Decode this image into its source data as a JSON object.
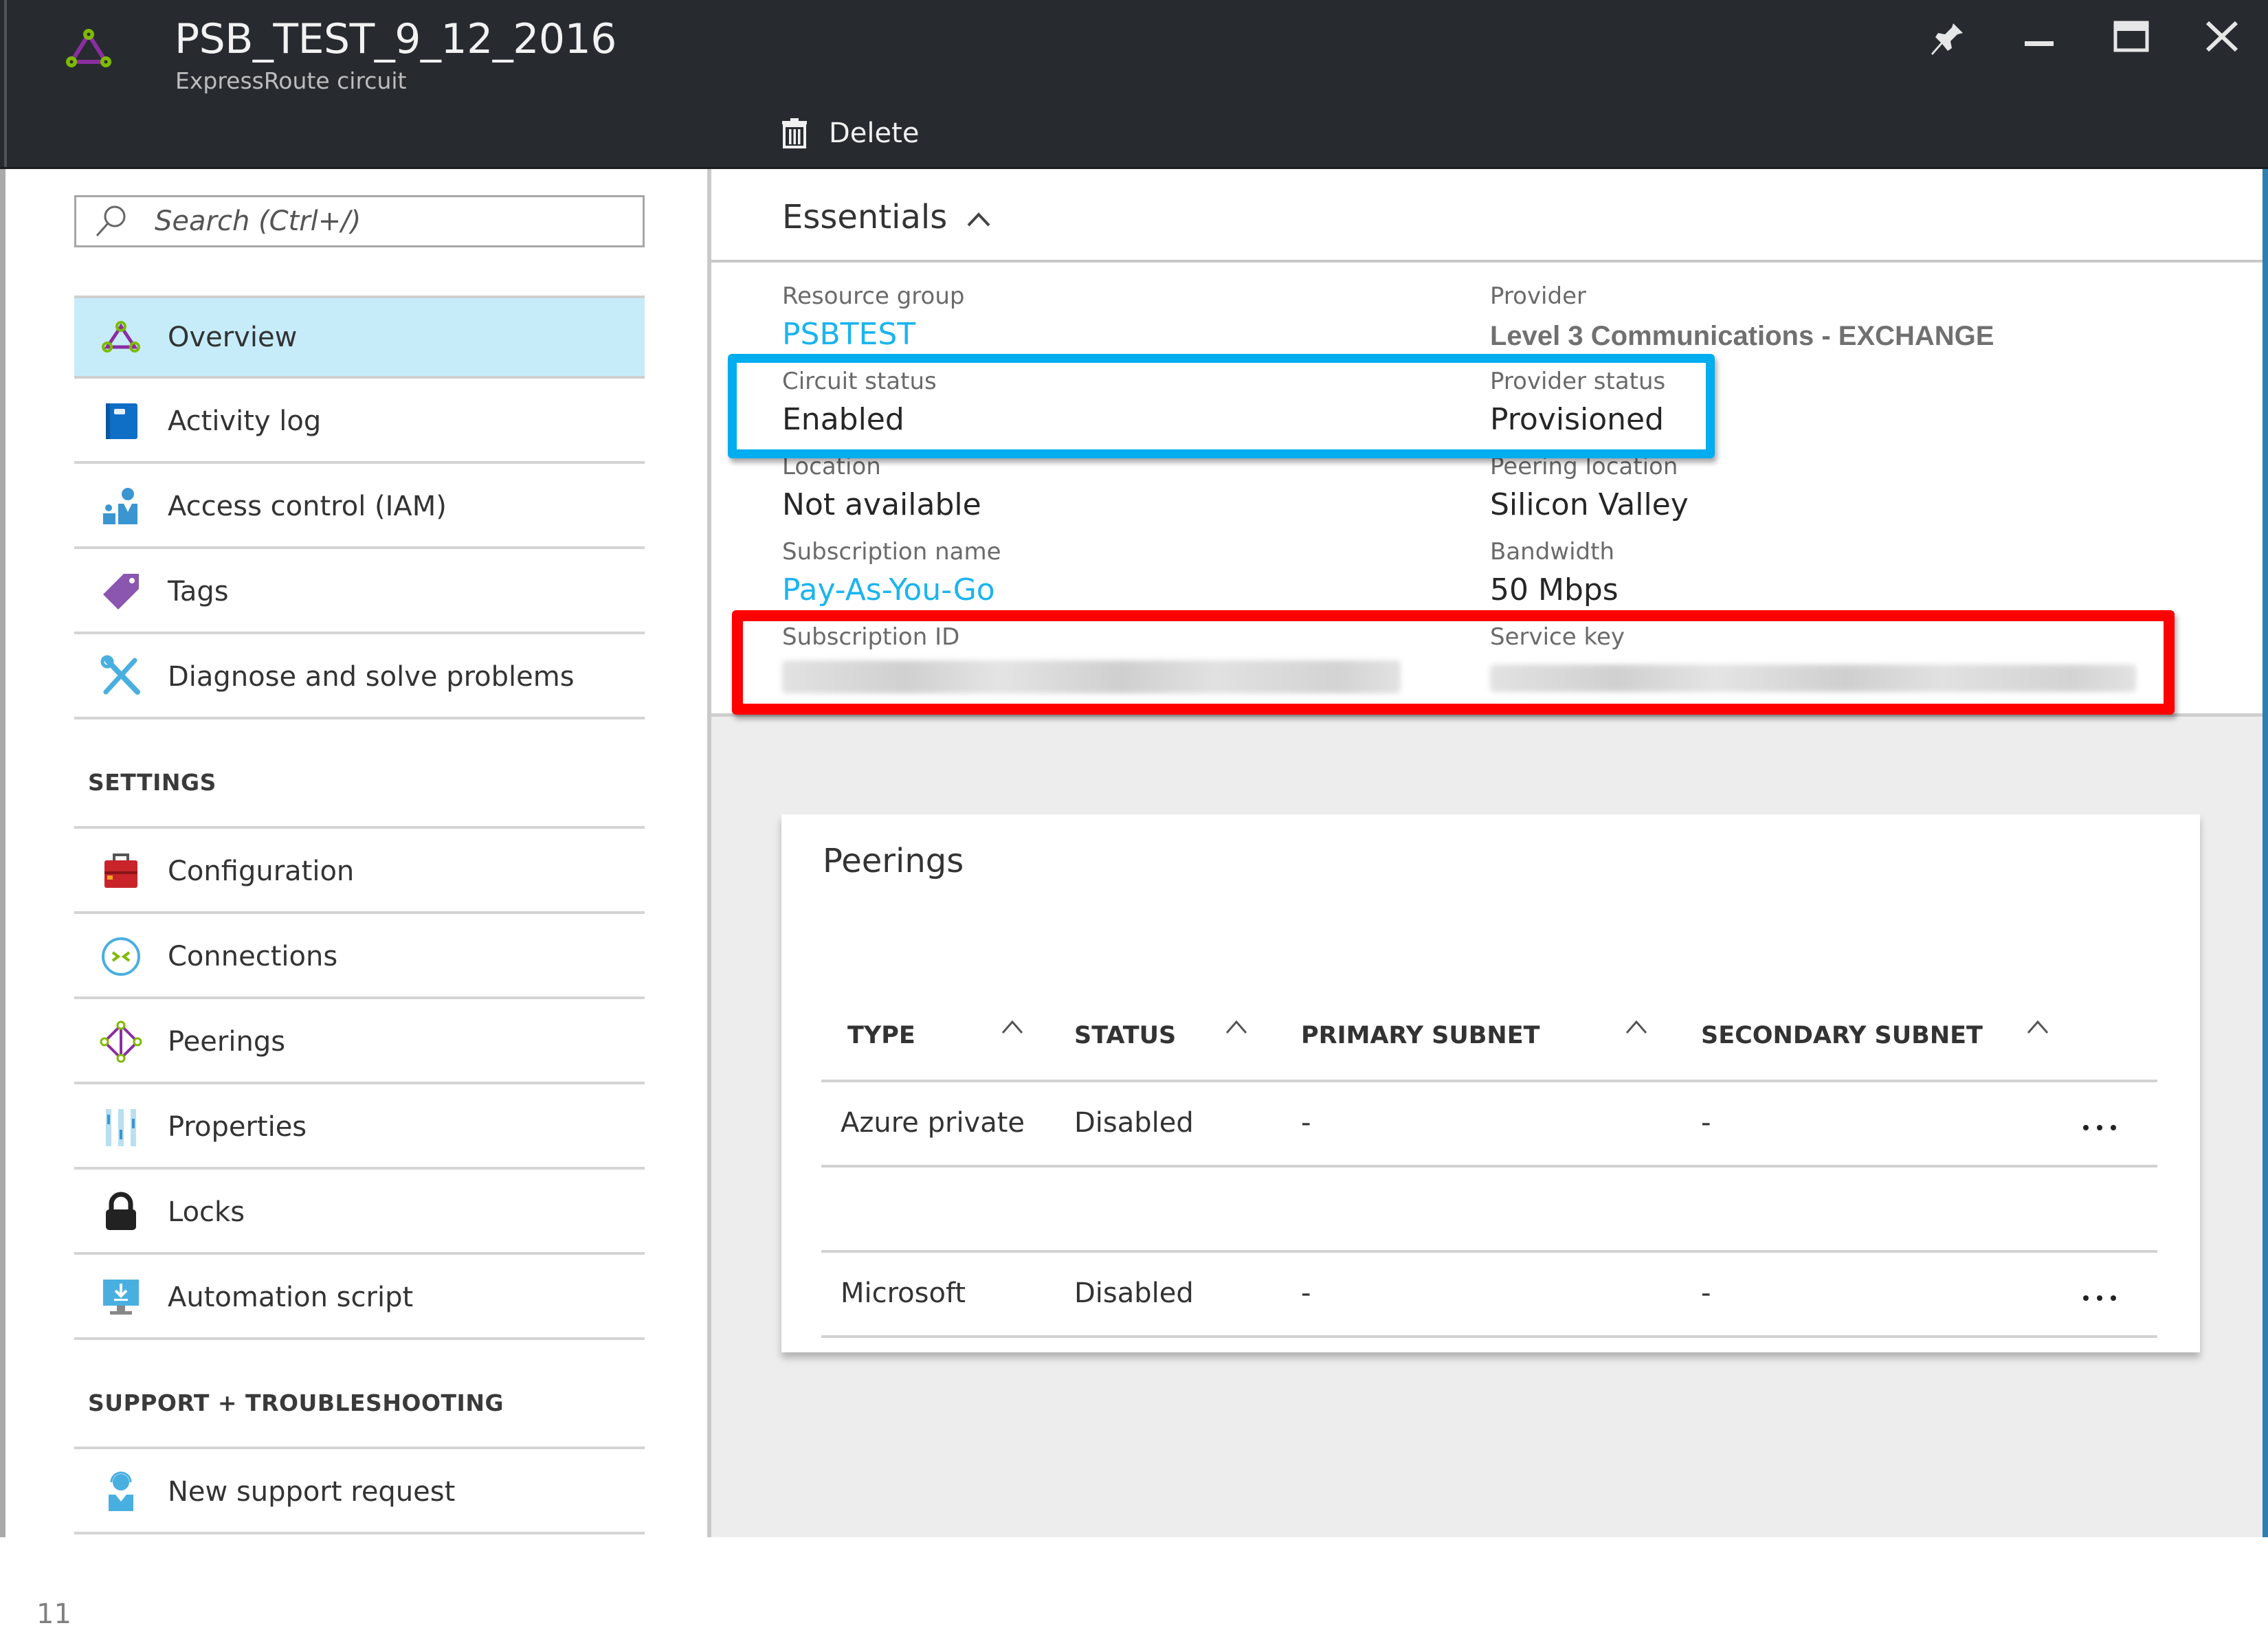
{
  "header": {
    "title": "PSB_TEST_9_12_2016",
    "subtitle": "ExpressRoute circuit",
    "resource_icon": "expressroute-circuit-icon",
    "window_controls": [
      "pin-icon",
      "minimize-icon",
      "maximize-icon",
      "close-icon"
    ],
    "delete_label": "Delete"
  },
  "sidebar": {
    "search_placeholder": "Search (Ctrl+/)",
    "items": [
      {
        "label": "Overview",
        "icon": "expressroute-icon",
        "active": true
      },
      {
        "label": "Activity log",
        "icon": "activity-log-icon"
      },
      {
        "label": "Access control (IAM)",
        "icon": "iam-icon"
      },
      {
        "label": "Tags",
        "icon": "tag-icon"
      },
      {
        "label": "Diagnose and solve problems",
        "icon": "wrench-icon"
      }
    ],
    "settings_label": "SETTINGS",
    "settings_items": [
      {
        "label": "Configuration",
        "icon": "toolbox-icon"
      },
      {
        "label": "Connections",
        "icon": "connections-icon"
      },
      {
        "label": "Peerings",
        "icon": "peerings-icon"
      },
      {
        "label": "Properties",
        "icon": "properties-icon"
      },
      {
        "label": "Locks",
        "icon": "lock-icon"
      },
      {
        "label": "Automation script",
        "icon": "automation-icon"
      }
    ],
    "support_label": "SUPPORT + TROUBLESHOOTING",
    "support_items": [
      {
        "label": "New support request",
        "icon": "support-icon"
      }
    ],
    "page_number": "11"
  },
  "essentials": {
    "title": "Essentials",
    "fields": {
      "resource_group": {
        "label": "Resource group",
        "value": "PSBTEST"
      },
      "provider": {
        "label": "Provider",
        "value": "Level 3 Communications - EXCHANGE"
      },
      "circuit_status": {
        "label": "Circuit status",
        "value": "Enabled"
      },
      "provider_status": {
        "label": "Provider status",
        "value": "Provisioned"
      },
      "location": {
        "label": "Location",
        "value": "Not available"
      },
      "peering_location": {
        "label": "Peering location",
        "value": "Silicon Valley"
      },
      "subscription_name": {
        "label": "Subscription name",
        "value": "Pay-As-You-Go"
      },
      "bandwidth": {
        "label": "Bandwidth",
        "value": "50 Mbps"
      },
      "subscription_id": {
        "label": "Subscription ID",
        "value": "(redacted)"
      },
      "service_key": {
        "label": "Service key",
        "value": "(redacted)"
      }
    },
    "highlights": {
      "status_box_color": "#00adee",
      "secret_box_color": "#ff0000"
    }
  },
  "peerings": {
    "title": "Peerings",
    "columns": [
      "TYPE",
      "STATUS",
      "PRIMARY SUBNET",
      "SECONDARY SUBNET"
    ],
    "rows": [
      {
        "type": "Azure private",
        "status": "Disabled",
        "primary": "-",
        "secondary": "-"
      },
      {
        "type": "",
        "status": "",
        "primary": "",
        "secondary": ""
      },
      {
        "type": "Microsoft",
        "status": "Disabled",
        "primary": "-",
        "secondary": "-"
      }
    ],
    "more_label": "..."
  },
  "colors": {
    "header_bg": "#272b30",
    "link": "#1ab4f0",
    "active_item": "#c6ecfa"
  }
}
